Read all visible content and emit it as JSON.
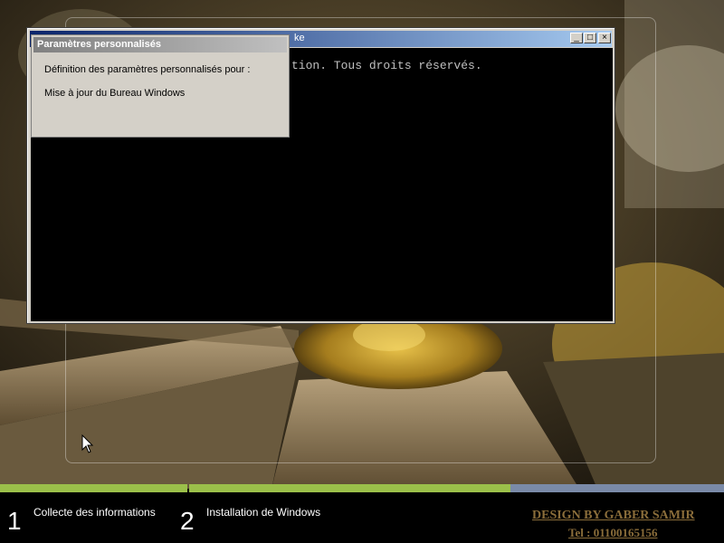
{
  "colors": {
    "progress_done": "#9bc04a",
    "progress_track": "#7a8aa8",
    "credit": "#8a6d3a"
  },
  "cmd_window": {
    "title": "ke",
    "minimize_label": "_",
    "maximize_label": "□",
    "close_label": "×",
    "lines": [
      "tion. Tous droits réservés."
    ]
  },
  "dialog": {
    "title": "Paramètres personnalisés",
    "line1": "Définition des paramètres personnalisés pour :",
    "line2": "Mise à jour du Bureau Windows"
  },
  "steps": [
    {
      "number": "1",
      "label": "Collecte des informations"
    },
    {
      "number": "2",
      "label": "Installation de Windows"
    }
  ],
  "credit": {
    "line1": "DESIGN BY GABER SAMIR",
    "line2": "Tel : 01100165156"
  },
  "progress": {
    "step1": 1.0,
    "step2": 0.6
  }
}
